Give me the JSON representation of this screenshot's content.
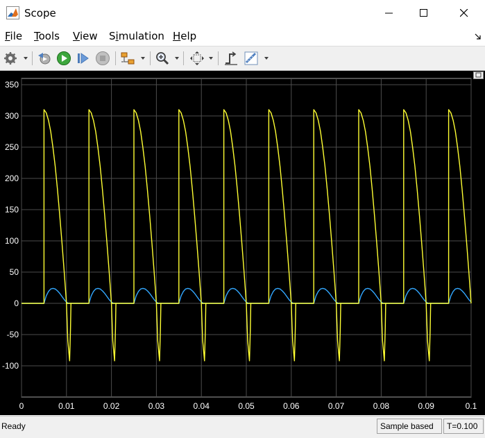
{
  "window": {
    "title": "Scope"
  },
  "menu": [
    {
      "mnemonic": "F",
      "rest": "ile"
    },
    {
      "mnemonic": "T",
      "rest": "ools"
    },
    {
      "mnemonic": "V",
      "rest": "iew"
    },
    {
      "pre": "S",
      "mnemonic": "i",
      "rest": "mulation"
    },
    {
      "mnemonic": "H",
      "rest": "elp"
    }
  ],
  "toolbar": {
    "buttons": [
      "settings-icon",
      "step-back-icon",
      "run-icon",
      "step-forward-icon",
      "stop-icon",
      "highlight-icon",
      "zoom-icon",
      "autoscale-icon",
      "triggers-icon",
      "measurements-icon"
    ]
  },
  "status": {
    "ready": "Ready",
    "sample_mode": "Sample based",
    "time": "T=0.100"
  },
  "colors": {
    "background": "#000000",
    "grid": "#4d4d4d",
    "axis_text": "#ffffff",
    "series_voltage": "#ffff33",
    "series_current": "#33a8ff"
  },
  "chart_data": {
    "type": "line",
    "xlim": [
      0,
      0.1
    ],
    "ylim": [
      -150,
      360
    ],
    "x_ticks": [
      "0",
      "0.01",
      "0.02",
      "0.03",
      "0.04",
      "0.05",
      "0.06",
      "0.07",
      "0.08",
      "0.09",
      "0.1"
    ],
    "y_ticks": [
      "-100",
      "-50",
      "0",
      "50",
      "100",
      "150",
      "200",
      "250",
      "300",
      "350"
    ],
    "grid": true,
    "series": [
      {
        "color": "#ffff33",
        "description": "pulsed rectifier output, peak ~310, negative spikes ~-92",
        "period": 0.01,
        "points": [
          [
            0,
            0
          ],
          [
            0.005,
            0
          ],
          [
            0.005,
            310
          ],
          [
            0.0055,
            305
          ],
          [
            0.006,
            293
          ],
          [
            0.0065,
            275
          ],
          [
            0.007,
            249
          ],
          [
            0.0075,
            219
          ],
          [
            0.008,
            182
          ],
          [
            0.0085,
            141
          ],
          [
            0.009,
            97
          ],
          [
            0.0095,
            50
          ],
          [
            0.01,
            0
          ],
          [
            0.0103,
            -60
          ],
          [
            0.0107,
            -92
          ],
          [
            0.0109,
            -40
          ],
          [
            0.011,
            0
          ],
          [
            0.015,
            0
          ]
        ]
      },
      {
        "color": "#33a8ff",
        "description": "load current, half-sine pulses peak ~24",
        "period": 0.01,
        "points": [
          [
            0,
            0
          ],
          [
            0.005,
            0
          ],
          [
            0.0055,
            12
          ],
          [
            0.006,
            19
          ],
          [
            0.0065,
            23
          ],
          [
            0.007,
            24
          ],
          [
            0.0075,
            23
          ],
          [
            0.008,
            20
          ],
          [
            0.0085,
            16
          ],
          [
            0.009,
            11
          ],
          [
            0.0095,
            6
          ],
          [
            0.01,
            2
          ],
          [
            0.0105,
            0
          ],
          [
            0.015,
            0
          ]
        ]
      }
    ]
  }
}
